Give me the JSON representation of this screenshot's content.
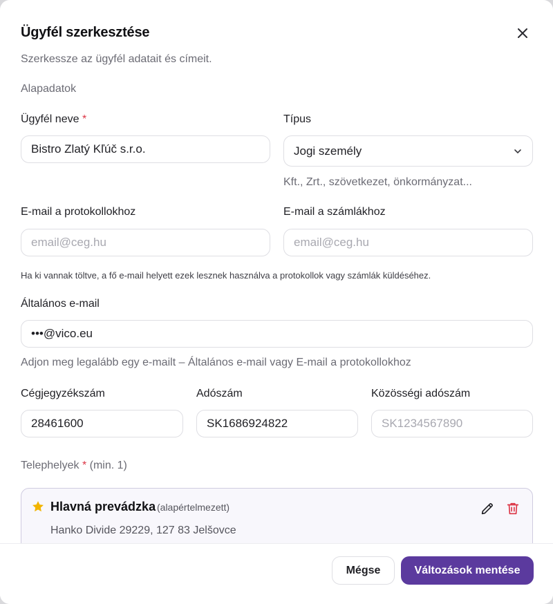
{
  "dialog": {
    "title": "Ügyfél szerkesztése",
    "subtitle": "Szerkessze az ügyfél adatait és címeit."
  },
  "basics": {
    "section_label": "Alapadatok",
    "client_name": {
      "label": "Ügyfél neve",
      "required_mark": "*",
      "value": "Bistro Zlatý Kľúč s.r.o."
    },
    "type": {
      "label": "Típus",
      "value": "Jogi személy",
      "hint": "Kft., Zrt., szövetkezet, önkormányzat..."
    },
    "email_protocol": {
      "label": "E-mail a protokollokhoz",
      "placeholder": "email@ceg.hu"
    },
    "email_invoice": {
      "label": "E-mail a számlákhoz",
      "placeholder": "email@ceg.hu"
    },
    "email_hint": "Ha ki vannak töltve, a fő e-mail helyett ezek lesznek használva a protokollok vagy számlák küldéséhez.",
    "general_email": {
      "label": "Általános e-mail",
      "value": "•••@vico.eu",
      "hint": "Adjon meg legalább egy e-mailt – Általános e-mail vagy E-mail a protokollokhoz"
    },
    "company_reg": {
      "label": "Cégjegyzékszám",
      "value": "28461600"
    },
    "tax_number": {
      "label": "Adószám",
      "value": "SK1686924822"
    },
    "eu_tax_number": {
      "label": "Közösségi adószám",
      "placeholder": "SK1234567890"
    }
  },
  "locations": {
    "label": "Telephelyek",
    "required_mark": "*",
    "min_note": "(min. 1)",
    "items": [
      {
        "name": "Hlavná prevádzka",
        "default_tag": "(alapértelmezett)",
        "address": "Hanko Divide 29229, 127 83 Jelšovce"
      }
    ]
  },
  "footer": {
    "cancel_label": "Mégse",
    "save_label": "Változások mentése"
  },
  "colors": {
    "primary": "#5b3a9e",
    "required": "#dc3545",
    "star": "#f2b400",
    "delete": "#dc3545"
  }
}
